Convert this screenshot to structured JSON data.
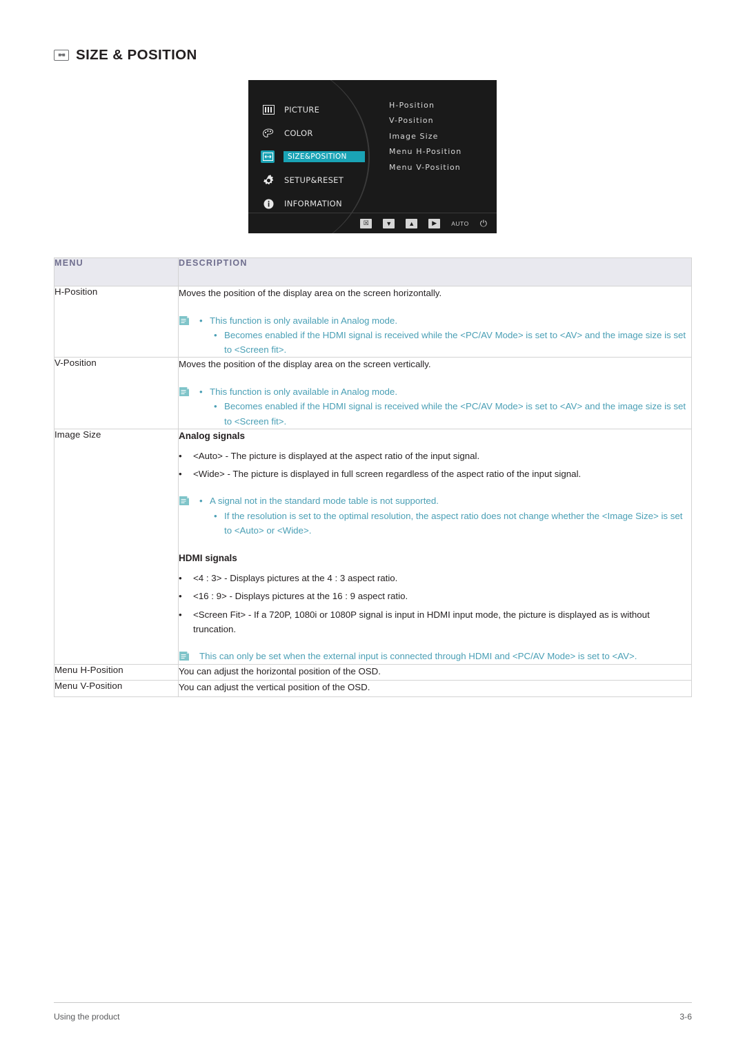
{
  "heading": {
    "icon": "size-position-icon",
    "title": "SIZE & POSITION"
  },
  "osd": {
    "menu_items": [
      {
        "icon": "picture-icon",
        "label": "PICTURE",
        "selected": false
      },
      {
        "icon": "color-palette-icon",
        "label": "COLOR",
        "selected": false
      },
      {
        "icon": "size-position-icon",
        "label": "SIZE&POSITION",
        "selected": true
      },
      {
        "icon": "gear-icon",
        "label": "SETUP&RESET",
        "selected": false
      },
      {
        "icon": "information-icon",
        "label": "INFORMATION",
        "selected": false
      }
    ],
    "submenu_items": [
      "H-Position",
      "V-Position",
      "Image Size",
      "Menu H-Position",
      "Menu V-Position"
    ],
    "buttons": [
      {
        "name": "exit-button",
        "glyph": "☒"
      },
      {
        "name": "down-button",
        "glyph": "▼"
      },
      {
        "name": "up-button",
        "glyph": "▲"
      },
      {
        "name": "enter-button",
        "glyph": "▶"
      },
      {
        "name": "auto-button",
        "glyph": "AUTO"
      },
      {
        "name": "power-button",
        "glyph": "⏻"
      }
    ]
  },
  "table": {
    "headers": {
      "menu": "MENU",
      "description": "DESCRIPTION"
    },
    "rows": [
      {
        "menu": "H-Position",
        "desc_main": "Moves the position of the display area on the screen horizontally.",
        "note_lines": [
          "This function is only available in Analog mode.",
          "Becomes enabled if the HDMI signal is received while the <PC/AV Mode> is set to <AV> and the image size is set to <Screen fit>."
        ]
      },
      {
        "menu": "V-Position",
        "desc_main": "Moves the position of the display area on the screen vertically.",
        "note_lines": [
          "This function is only available in Analog mode.",
          "Becomes enabled if the HDMI signal is received while the <PC/AV Mode> is set to <AV> and the image size is set to <Screen fit>."
        ]
      },
      {
        "menu": "Image Size",
        "analog_heading": "Analog signals",
        "analog_bullets": [
          "<Auto> - The picture is displayed at the aspect ratio of the input signal.",
          "<Wide> - The picture is displayed in full screen regardless of the aspect ratio of the input signal."
        ],
        "analog_note_lines": [
          "A signal not in the standard mode table is not supported.",
          "If the resolution is set to the optimal resolution, the aspect ratio does not change whether the <Image Size> is set to <Auto> or <Wide>."
        ],
        "hdmi_heading": "HDMI signals",
        "hdmi_bullets": [
          "<4 : 3> - Displays pictures at the 4 : 3 aspect ratio.",
          "<16 : 9> - Displays pictures at the 16 : 9 aspect ratio.",
          "<Screen Fit> - If a 720P, 1080i or 1080P signal is input in HDMI input mode, the picture is displayed as is without truncation."
        ],
        "hdmi_note": "This can only be set when the external input is connected through HDMI and <PC/AV Mode> is set to <AV>."
      },
      {
        "menu": "Menu H-Position",
        "desc_main": "You can adjust the horizontal position of the OSD."
      },
      {
        "menu": "Menu V-Position",
        "desc_main": "You can adjust the vertical position of the OSD."
      }
    ]
  },
  "footer": {
    "left": "Using the product",
    "right": "3-6"
  }
}
